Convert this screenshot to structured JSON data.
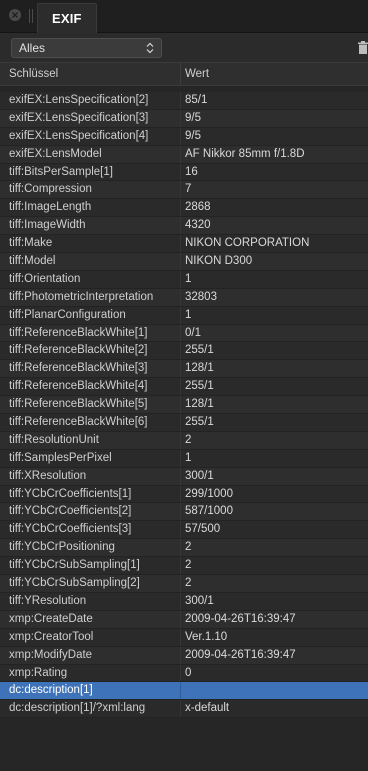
{
  "panel": {
    "tab_label": "EXIF",
    "close_icon": "close-icon",
    "grip_icon": "drag-grip-icon"
  },
  "toolbar": {
    "filter_value": "Alles",
    "filter_icon": "up-down-chevron-icon",
    "delete_icon": "trash-icon"
  },
  "table": {
    "columns": [
      "Schlüssel",
      "Wert"
    ],
    "rows": [
      {
        "key": "exifEX:LensSpecification[2]",
        "value": "85/1"
      },
      {
        "key": "exifEX:LensSpecification[3]",
        "value": "9/5"
      },
      {
        "key": "exifEX:LensSpecification[4]",
        "value": "9/5"
      },
      {
        "key": "exifEX:LensModel",
        "value": "AF Nikkor 85mm f/1.8D"
      },
      {
        "key": "tiff:BitsPerSample[1]",
        "value": "16"
      },
      {
        "key": "tiff:Compression",
        "value": "7"
      },
      {
        "key": "tiff:ImageLength",
        "value": "2868"
      },
      {
        "key": "tiff:ImageWidth",
        "value": "4320"
      },
      {
        "key": "tiff:Make",
        "value": "NIKON CORPORATION"
      },
      {
        "key": "tiff:Model",
        "value": "NIKON D300"
      },
      {
        "key": "tiff:Orientation",
        "value": "1"
      },
      {
        "key": "tiff:PhotometricInterpretation",
        "value": "32803"
      },
      {
        "key": "tiff:PlanarConfiguration",
        "value": "1"
      },
      {
        "key": "tiff:ReferenceBlackWhite[1]",
        "value": "0/1"
      },
      {
        "key": "tiff:ReferenceBlackWhite[2]",
        "value": "255/1"
      },
      {
        "key": "tiff:ReferenceBlackWhite[3]",
        "value": "128/1"
      },
      {
        "key": "tiff:ReferenceBlackWhite[4]",
        "value": "255/1"
      },
      {
        "key": "tiff:ReferenceBlackWhite[5]",
        "value": "128/1"
      },
      {
        "key": "tiff:ReferenceBlackWhite[6]",
        "value": "255/1"
      },
      {
        "key": "tiff:ResolutionUnit",
        "value": "2"
      },
      {
        "key": "tiff:SamplesPerPixel",
        "value": "1"
      },
      {
        "key": "tiff:XResolution",
        "value": "300/1"
      },
      {
        "key": "tiff:YCbCrCoefficients[1]",
        "value": "299/1000"
      },
      {
        "key": "tiff:YCbCrCoefficients[2]",
        "value": "587/1000"
      },
      {
        "key": "tiff:YCbCrCoefficients[3]",
        "value": "57/500"
      },
      {
        "key": "tiff:YCbCrPositioning",
        "value": "2"
      },
      {
        "key": "tiff:YCbCrSubSampling[1]",
        "value": "2"
      },
      {
        "key": "tiff:YCbCrSubSampling[2]",
        "value": "2"
      },
      {
        "key": "tiff:YResolution",
        "value": "300/1"
      },
      {
        "key": "xmp:CreateDate",
        "value": "2009-04-26T16:39:47"
      },
      {
        "key": "xmp:CreatorTool",
        "value": "Ver.1.10"
      },
      {
        "key": "xmp:ModifyDate",
        "value": "2009-04-26T16:39:47"
      },
      {
        "key": "xmp:Rating",
        "value": "0"
      },
      {
        "key": "dc:description[1]",
        "value": "",
        "selected": true
      },
      {
        "key": "dc:description[1]/?xml:lang",
        "value": "x-default"
      }
    ]
  },
  "colors": {
    "selection": "#3e73b9",
    "background": "#262626"
  }
}
